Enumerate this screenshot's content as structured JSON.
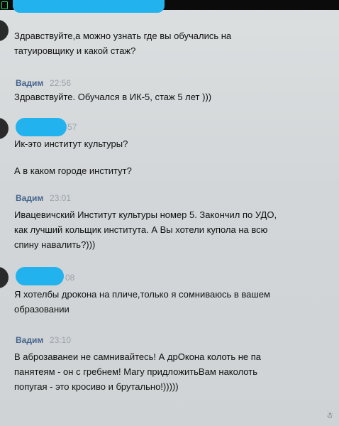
{
  "messages": [
    {
      "author": "",
      "time": "",
      "lines": [
        "Здравствуйте,а можно узнать где вы обучались на",
        "татуировщику и какой стаж?"
      ]
    },
    {
      "author": "Вадим",
      "time": "22:56",
      "lines": [
        "Здравствуйте. Обучался в ИК-5, стаж 5 лет )))"
      ]
    },
    {
      "author": "",
      "time": "57",
      "lines": [
        "Ик-это институт культуры?"
      ],
      "extra_lines": [
        "А в каком городе институт?"
      ]
    },
    {
      "author": "Вадим",
      "time": "23:01",
      "lines": [
        "Ивацевичский Институт культуры номер 5. Закончил по УДО,",
        "как лучший кольщик института. А Вы хотели купола на всю",
        "спину навалить?)))"
      ]
    },
    {
      "author": "",
      "time": "08",
      "lines": [
        "Я хотелбы дрокона на пличе,только я сомниваюсь в вашем",
        "образовании"
      ]
    },
    {
      "author": "Вадим",
      "time": "23:10",
      "lines": [
        "В аброзаванеи не самнивайтесь! А дрОкона колоть не па",
        "панятеям - он с гребнем! Магу придложитьВам наколоть",
        "попугая - это кросиво и брутально!)))))"
      ]
    }
  ]
}
